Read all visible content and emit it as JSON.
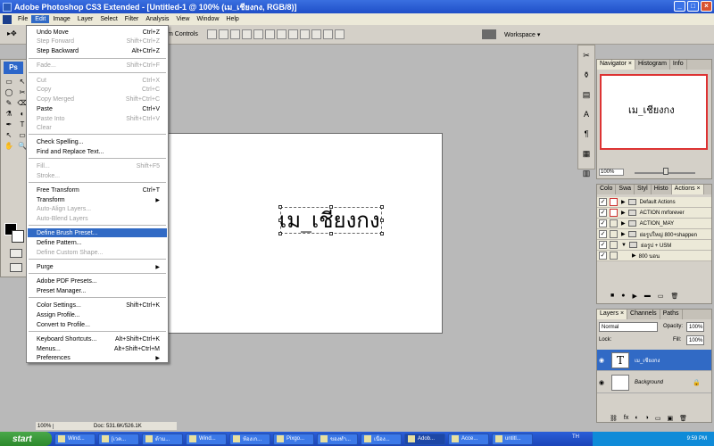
{
  "window": {
    "title": "Adobe Photoshop CS3 Extended - [Untitled-1 @ 100% (เม_เชียงกง, RGB/8)]",
    "controls": [
      "_",
      "□",
      "×"
    ]
  },
  "menubar": [
    "File",
    "Edit",
    "Image",
    "Layer",
    "Select",
    "Filter",
    "Analysis",
    "View",
    "Window",
    "Help"
  ],
  "options_bar": {
    "transform_label": "m Controls",
    "workspace_label": "Workspace ▾"
  },
  "toolbox": {
    "logo": "Ps",
    "tools": [
      "▭",
      "↖",
      "◯",
      "✂",
      "✎",
      "⌫",
      "⚗",
      "◐",
      "✒",
      "T",
      "↖",
      "▭",
      "✋",
      "🔍"
    ]
  },
  "edit_menu": {
    "items": [
      {
        "label": "Undo Move",
        "shortcut": "Ctrl+Z",
        "disabled": false
      },
      {
        "label": "Step Forward",
        "shortcut": "Shift+Ctrl+Z",
        "disabled": true
      },
      {
        "label": "Step Backward",
        "shortcut": "Alt+Ctrl+Z",
        "disabled": false
      },
      {
        "label": "Fade...",
        "shortcut": "Shift+Ctrl+F",
        "disabled": true
      },
      {
        "label": "Cut",
        "shortcut": "Ctrl+X",
        "disabled": true
      },
      {
        "label": "Copy",
        "shortcut": "Ctrl+C",
        "disabled": true
      },
      {
        "label": "Copy Merged",
        "shortcut": "Shift+Ctrl+C",
        "disabled": true
      },
      {
        "label": "Paste",
        "shortcut": "Ctrl+V",
        "disabled": false
      },
      {
        "label": "Paste Into",
        "shortcut": "Shift+Ctrl+V",
        "disabled": true
      },
      {
        "label": "Clear",
        "shortcut": "",
        "disabled": true
      },
      {
        "label": "Check Spelling...",
        "shortcut": "",
        "disabled": false
      },
      {
        "label": "Find and Replace Text...",
        "shortcut": "",
        "disabled": false
      },
      {
        "label": "Fill...",
        "shortcut": "Shift+F5",
        "disabled": true
      },
      {
        "label": "Stroke...",
        "shortcut": "",
        "disabled": true
      },
      {
        "label": "Free Transform",
        "shortcut": "Ctrl+T",
        "disabled": false
      },
      {
        "label": "Transform",
        "shortcut": "▶",
        "disabled": false
      },
      {
        "label": "Auto-Align Layers...",
        "shortcut": "",
        "disabled": true
      },
      {
        "label": "Auto-Blend Layers",
        "shortcut": "",
        "disabled": true
      },
      {
        "label": "Define Brush Preset...",
        "shortcut": "",
        "disabled": false
      },
      {
        "label": "Define Pattern...",
        "shortcut": "",
        "disabled": false
      },
      {
        "label": "Define Custom Shape...",
        "shortcut": "",
        "disabled": true
      },
      {
        "label": "Purge",
        "shortcut": "▶",
        "disabled": false
      },
      {
        "label": "Adobe PDF Presets...",
        "shortcut": "",
        "disabled": false
      },
      {
        "label": "Preset Manager...",
        "shortcut": "",
        "disabled": false
      },
      {
        "label": "Color Settings...",
        "shortcut": "Shift+Ctrl+K",
        "disabled": false
      },
      {
        "label": "Assign Profile...",
        "shortcut": "",
        "disabled": false
      },
      {
        "label": "Convert to Profile...",
        "shortcut": "",
        "disabled": false
      },
      {
        "label": "Keyboard Shortcuts...",
        "shortcut": "Alt+Shift+Ctrl+K",
        "disabled": false
      },
      {
        "label": "Menus...",
        "shortcut": "Alt+Shift+Ctrl+M",
        "disabled": false
      },
      {
        "label": "Preferences",
        "shortcut": "▶",
        "disabled": false
      }
    ],
    "highlighted_label": "Define Brush Preset..."
  },
  "canvas": {
    "text": "เม_เชียงกง"
  },
  "statusbar": {
    "zoom": "100%",
    "doc": "Doc: 531.6K/526.1K"
  },
  "panel_strip": [
    "✂",
    "⚱",
    "▤",
    "A",
    "¶",
    "▦",
    "▥"
  ],
  "navigator": {
    "tabs": [
      "Navigator ×",
      "Histogram",
      "Info"
    ],
    "preview_text": "เม_เชียงกง",
    "zoom": "100%"
  },
  "actions_panel": {
    "tabs": [
      "Colo",
      "Swa",
      "Styl",
      "Histo",
      "Actions ×"
    ],
    "rows": [
      {
        "label": "Default Actions",
        "indent": 0,
        "red_dialog": true
      },
      {
        "label": "ACTION mrforever",
        "indent": 0,
        "red_dialog": true
      },
      {
        "label": "ACTION_MAY",
        "indent": 0,
        "red_dialog": false
      },
      {
        "label": "ย่อรูปใหญ่ 800+shappen",
        "indent": 0,
        "red_dialog": false
      },
      {
        "label": "ย่อรูป + USM",
        "indent": 0,
        "red_dialog": false
      },
      {
        "label": "800 นอน",
        "indent": 1,
        "red_dialog": false
      }
    ],
    "footer_icons": [
      "■",
      "●",
      "▶",
      "▬",
      "▭",
      "🗑"
    ]
  },
  "layers_panel": {
    "tabs": [
      "Layers ×",
      "Channels",
      "Paths"
    ],
    "blend_mode": "Normal",
    "opacity_label": "Opacity:",
    "opacity": "100%",
    "lock_label": "Lock:",
    "fill_label": "Fill:",
    "fill": "100%",
    "layers": [
      {
        "name": "เม_เชียงกง",
        "thumb": "T",
        "selected": true,
        "locked": false
      },
      {
        "name": "Background",
        "thumb": "",
        "selected": false,
        "locked": true
      }
    ],
    "footer_icons": [
      "⛓",
      "fx",
      "◐",
      "◑",
      "▭",
      "▣",
      "🗑"
    ]
  },
  "taskbar": {
    "start_label": "start",
    "tasks": [
      "Wind...",
      "[เวค...",
      "ต้าม...",
      "Wind...",
      "ห้องเก...",
      "Pixgo...",
      "ของทำ...",
      "เนื่อง...",
      "Adob...",
      "Acce...",
      "untitl..."
    ],
    "active_task": "Adob...",
    "lang": "TH",
    "clock": "9:59 PM"
  }
}
